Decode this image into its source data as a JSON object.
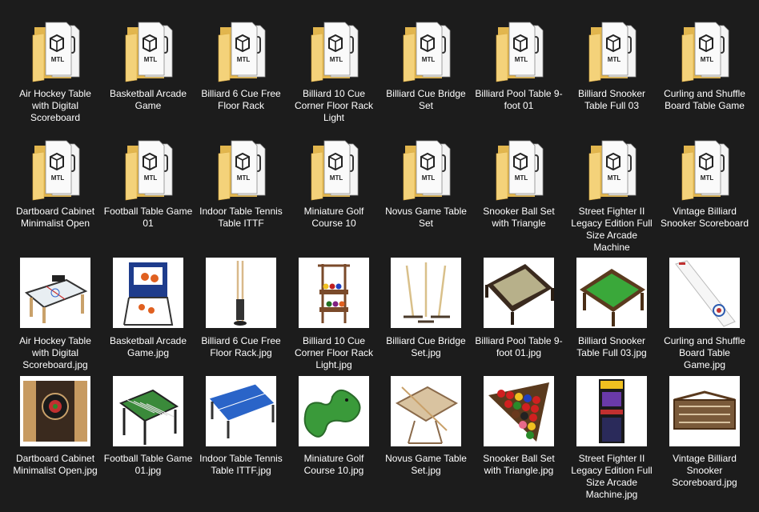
{
  "folders": [
    {
      "label": "Air Hockey Table with Digital Scoreboard",
      "icon": "folder-mtl-icon"
    },
    {
      "label": "Basketball Arcade Game",
      "icon": "folder-mtl-icon"
    },
    {
      "label": "Billiard 6 Cue Free Floor Rack",
      "icon": "folder-mtl-icon"
    },
    {
      "label": "Billiard 10 Cue Corner Floor Rack Light",
      "icon": "folder-mtl-icon"
    },
    {
      "label": "Billiard Cue Bridge Set",
      "icon": "folder-mtl-icon"
    },
    {
      "label": "Billiard Pool Table 9-foot 01",
      "icon": "folder-mtl-icon"
    },
    {
      "label": "Billiard Snooker Table Full 03",
      "icon": "folder-mtl-icon"
    },
    {
      "label": "Curling and Shuffle Board Table Game",
      "icon": "folder-mtl-icon"
    },
    {
      "label": "Dartboard Cabinet Minimalist Open",
      "icon": "folder-mtl-icon"
    },
    {
      "label": "Football Table Game 01",
      "icon": "folder-mtl-icon"
    },
    {
      "label": "Indoor Table Tennis Table ITTF",
      "icon": "folder-mtl-icon"
    },
    {
      "label": "Miniature Golf Course 10",
      "icon": "folder-mtl-icon"
    },
    {
      "label": "Novus Game Table Set",
      "icon": "folder-mtl-icon"
    },
    {
      "label": "Snooker Ball Set with Triangle",
      "icon": "folder-mtl-icon"
    },
    {
      "label": "Street Fighter II Legacy Edition Full Size Arcade Machine",
      "icon": "folder-mtl-icon"
    },
    {
      "label": "Vintage Billiard Snooker Scoreboard",
      "icon": "folder-mtl-icon"
    }
  ],
  "images": [
    {
      "label": "Air Hockey Table with Digital Scoreboard.jpg",
      "icon": "air-hockey-table-thumbnail"
    },
    {
      "label": "Basketball Arcade Game.jpg",
      "icon": "basketball-arcade-thumbnail"
    },
    {
      "label": "Billiard 6 Cue Free Floor Rack.jpg",
      "icon": "cue-floor-rack-thumbnail"
    },
    {
      "label": "Billiard 10 Cue Corner Floor Rack Light.jpg",
      "icon": "corner-cue-rack-thumbnail"
    },
    {
      "label": "Billiard Cue Bridge Set.jpg",
      "icon": "cue-bridge-set-thumbnail"
    },
    {
      "label": "Billiard Pool Table 9-foot 01.jpg",
      "icon": "pool-table-thumbnail"
    },
    {
      "label": "Billiard Snooker Table Full 03.jpg",
      "icon": "snooker-table-thumbnail"
    },
    {
      "label": "Curling and Shuffle Board Table Game.jpg",
      "icon": "shuffleboard-thumbnail"
    },
    {
      "label": "Dartboard Cabinet Minimalist Open.jpg",
      "icon": "dartboard-cabinet-thumbnail"
    },
    {
      "label": "Football Table Game 01.jpg",
      "icon": "foosball-table-thumbnail"
    },
    {
      "label": "Indoor Table Tennis Table ITTF.jpg",
      "icon": "table-tennis-thumbnail"
    },
    {
      "label": "Miniature Golf Course 10.jpg",
      "icon": "mini-golf-thumbnail"
    },
    {
      "label": "Novus Game Table Set.jpg",
      "icon": "novus-table-thumbnail"
    },
    {
      "label": "Snooker Ball Set with Triangle.jpg",
      "icon": "snooker-balls-thumbnail"
    },
    {
      "label": "Street Fighter II Legacy Edition Full Size Arcade Machine.jpg",
      "icon": "arcade-machine-thumbnail"
    },
    {
      "label": "Vintage Billiard Snooker Scoreboard.jpg",
      "icon": "scoreboard-thumbnail"
    }
  ],
  "folder_badge_text": "MTL",
  "colors": {
    "background": "#1c1c1c",
    "folder": "#f4d27a",
    "folder_dark": "#e2b64e",
    "label": "#ffffff"
  }
}
